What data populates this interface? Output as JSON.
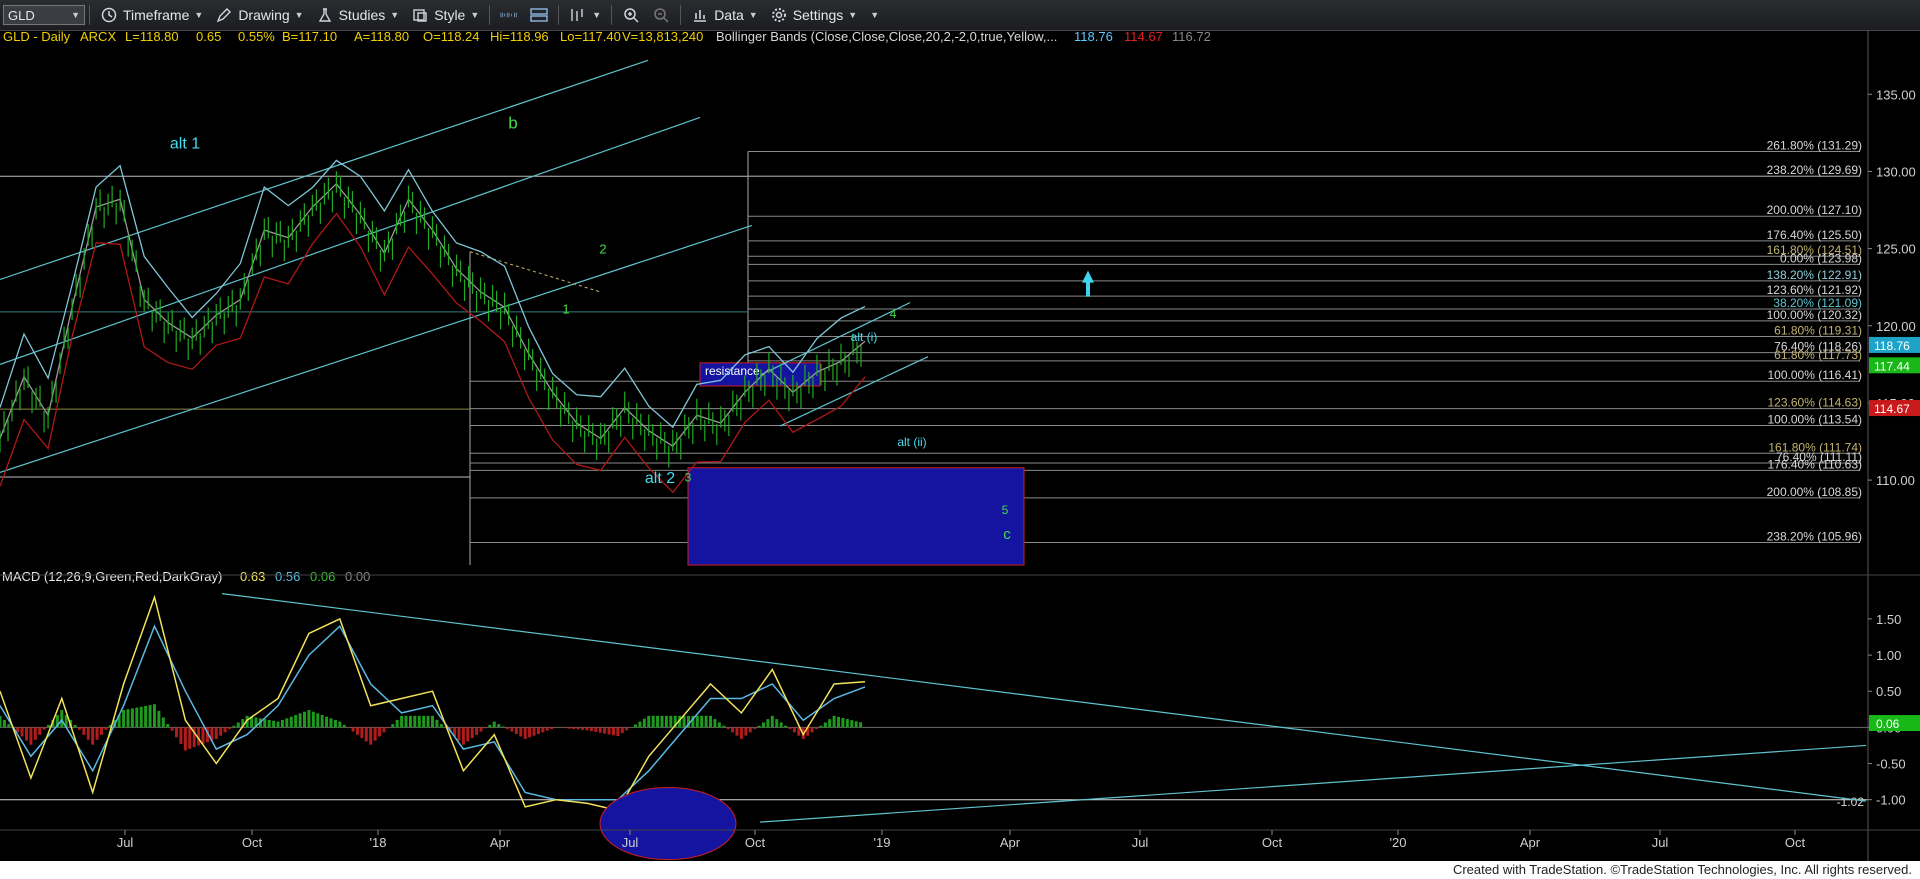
{
  "toolbar": {
    "symbol": "GLD",
    "timeframe": "Timeframe",
    "drawing": "Drawing",
    "studies": "Studies",
    "style": "Style",
    "data": "Data",
    "settings": "Settings"
  },
  "price_header": {
    "symbol_info": "GLD - Daily",
    "exchange": "ARCX",
    "last": "L=118.80",
    "change": "0.65",
    "change_pct": "0.55%",
    "bid": "B=117.10",
    "ask": "A=118.80",
    "open": "O=118.24",
    "high": "Hi=118.96",
    "low": "Lo=117.40",
    "volume": "V=13,813,240",
    "bollinger": "Bollinger Bands (Close,Close,Close,20,2,-2,0,true,Yellow,...",
    "bb_upper": "118.76",
    "bb_lower": "114.67",
    "bb_mid": "116.72"
  },
  "macd_header": {
    "label": "MACD (12,26,9,Green,Red,DarkGray)",
    "v1": "0.63",
    "v2": "0.56",
    "v3": "0.06",
    "v4": "0.00"
  },
  "footer": "Created with TradeStation. ©TradeStation Technologies, Inc. All rights reserved.",
  "colors": {
    "price_up": "#22aa22",
    "teal_line": "#5fc3cf",
    "bb_red": "#b01818",
    "macd_yellow": "#f2e25a",
    "macd_blue": "#59b9e3",
    "hist_green": "#1f9a1f",
    "hist_red": "#b01c1c",
    "zone_blue": "#1414a0",
    "wave_green": "#44dd44",
    "alt_cyan": "#44dcef"
  },
  "chart_data": [
    {
      "type": "line",
      "title": "GLD - Daily",
      "x": [
        "Jul",
        "Oct",
        "'18",
        "Apr",
        "Jul",
        "Oct",
        "'19",
        "Apr",
        "Jul",
        "Oct",
        "'20",
        "Apr",
        "Jul",
        "Oct"
      ],
      "ylim": [
        104.5,
        138
      ],
      "y_ticks": [
        "135.00",
        "130.00",
        "125.00",
        "120.00",
        "115.00",
        "110.00"
      ],
      "series": [
        {
          "values": [
            112.5,
            116.5,
            114,
            121,
            127.5,
            128,
            121.5,
            120,
            119,
            120.5,
            121.5,
            126,
            125.5,
            127.5,
            129,
            127,
            124.5,
            128,
            126,
            123.5,
            122,
            121,
            118,
            115.5,
            113.5,
            112.5,
            114.5,
            113,
            112,
            114,
            113.5,
            115.5,
            117,
            115.5,
            116.8,
            117.5,
            118.8
          ]
        }
      ],
      "last_price": "118.76",
      "price_badges": [
        "118.76",
        "117.44",
        "114.67"
      ],
      "fib_levels": [
        {
          "label": "261.80% (131.29)",
          "value": 131.29
        },
        {
          "label": "238.20% (129.69)",
          "value": 129.69
        },
        {
          "label": "200.00% (127.10)",
          "value": 127.1
        },
        {
          "label": "176.40% (125.50)",
          "value": 125.5
        },
        {
          "label": "161.80% (124.51)",
          "value": 124.51
        },
        {
          "label": "0.00% (123.98)",
          "value": 123.98
        },
        {
          "label": "138.20% (122.91)",
          "value": 122.91
        },
        {
          "label": "123.60% (121.92)",
          "value": 121.92
        },
        {
          "label": "38.20% (121.09)",
          "value": 121.09
        },
        {
          "label": "100.00% (120.32)",
          "value": 120.32
        },
        {
          "label": "61.80% (119.31)",
          "value": 119.31
        },
        {
          "label": "76.40% (118.26)",
          "value": 118.26
        },
        {
          "label": "61.80% (117.73)",
          "value": 117.73
        },
        {
          "label": "100.00% (116.41)",
          "value": 116.41
        },
        {
          "label": "123.60% (114.63)",
          "value": 114.63
        },
        {
          "label": "100.00% (113.54)",
          "value": 113.54
        },
        {
          "label": "161.80% (111.74)",
          "value": 111.74
        },
        {
          "label": "76.40% (111.11)",
          "value": 111.11
        },
        {
          "label": "176.40% (110.63)",
          "value": 110.63
        },
        {
          "label": "200.00% (108.85)",
          "value": 108.85
        },
        {
          "label": "238.20% (105.96)",
          "value": 105.96
        }
      ],
      "annotations": [
        "alt 1",
        "b",
        "2",
        "1",
        "resistance",
        "4",
        "alt (i)",
        "alt (ii)",
        "alt 2",
        "3",
        "5",
        "c"
      ]
    },
    {
      "type": "line",
      "title": "MACD (12,26,9,Green,Red,DarkGray)",
      "ylim": [
        -1.35,
        1.9
      ],
      "y_ticks": [
        "1.50",
        "1.00",
        "0.50",
        "0.00",
        "-0.50",
        "-1.00"
      ],
      "series": [
        {
          "name": "MACD",
          "values": [
            0.5,
            -0.7,
            0.4,
            -0.9,
            0.6,
            1.8,
            0.1,
            -0.5,
            0.1,
            0.4,
            1.3,
            1.5,
            0.3,
            0.4,
            0.5,
            -0.6,
            -0.1,
            -1.1,
            -1.0,
            -1.05,
            -1.15,
            -0.4,
            0.1,
            0.6,
            0.2,
            0.8,
            -0.1,
            0.6,
            0.63
          ]
        },
        {
          "name": "Signal",
          "values": [
            0.3,
            -0.4,
            0.1,
            -0.6,
            0.3,
            1.4,
            0.5,
            -0.3,
            -0.1,
            0.3,
            1.0,
            1.4,
            0.6,
            0.2,
            0.3,
            -0.3,
            -0.2,
            -0.9,
            -1.0,
            -1.0,
            -1.0,
            -0.6,
            -0.1,
            0.4,
            0.4,
            0.6,
            0.1,
            0.4,
            0.56
          ]
        }
      ],
      "badge": "0.06",
      "trendline_label": "-1.02"
    }
  ]
}
